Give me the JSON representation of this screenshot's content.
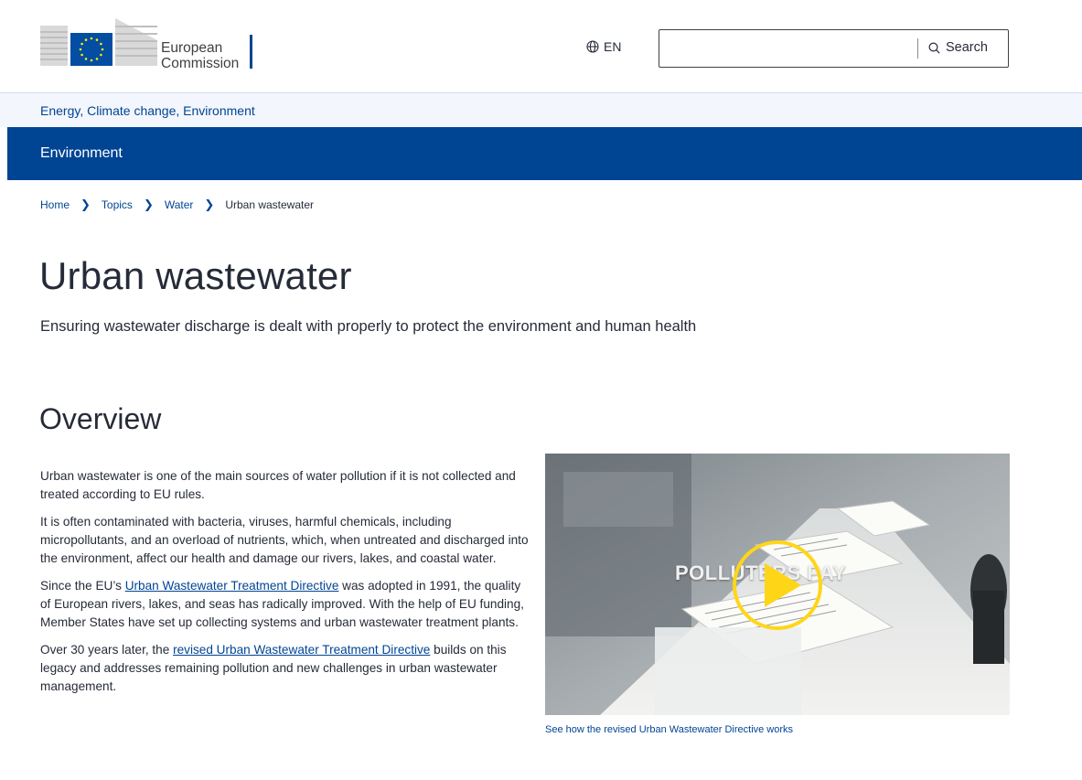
{
  "header": {
    "logo_line1": "European",
    "logo_line2": "Commission",
    "language": "EN",
    "search_placeholder": "",
    "search_label": "Search"
  },
  "site": {
    "topics": "Energy, Climate change, Environment",
    "section": "Environment"
  },
  "breadcrumb": {
    "items": [
      "Home",
      "Topics",
      "Water"
    ],
    "current": "Urban wastewater"
  },
  "page": {
    "title": "Urban wastewater",
    "subtitle": "Ensuring wastewater discharge is dealt with properly to protect the environment and human health"
  },
  "overview": {
    "heading": "Overview",
    "p1": "Urban wastewater is one of the main sources of water pollution if it is not collected and treated according to EU rules.",
    "p2": "It is often contaminated with bacteria, viruses, harmful chemicals, including micropollutants, and an overload of nutrients, which, when untreated and discharged into the environment, affect our health and damage our rivers, lakes, and coastal water.",
    "p3_pre": "Since the EU’s ",
    "p3_link": "Urban Wastewater Treatment Directive",
    "p3_post": " was adopted in 1991, the quality of European rivers, lakes, and seas has radically improved. With the help of EU funding, Member States have set up collecting systems and urban wastewater treatment plants.",
    "p4_pre": "Over 30 years later, the ",
    "p4_link": "revised Urban Wastewater Treatment Directive",
    "p4_post": " builds on this legacy and addresses remaining pollution and new challenges in urban wastewater management."
  },
  "video": {
    "overlay_text": "POLLUTERS PAY",
    "caption": "See how the revised Urban Wastewater Directive works"
  },
  "colors": {
    "brand_blue": "#004494",
    "play_yellow": "#ffd617",
    "text": "#262b38",
    "site_bar_bg": "#f3f6fc"
  }
}
